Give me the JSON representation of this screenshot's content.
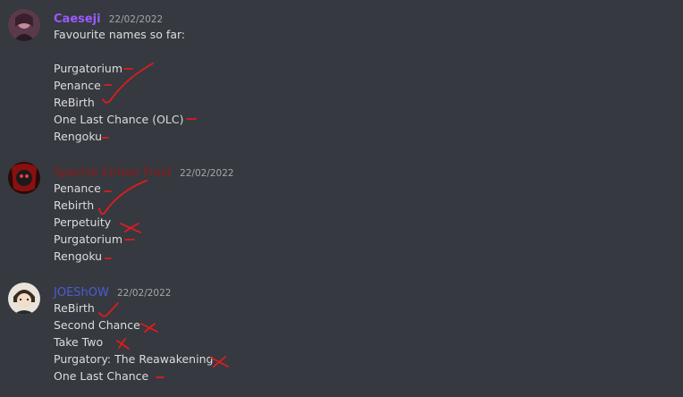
{
  "messages": [
    {
      "author": "Caeseji",
      "author_color": "#9b59ff",
      "timestamp": "22/02/2022",
      "lines": [
        "Favourite names so far:",
        "",
        "Purgatorium",
        "Penance",
        "ReBirth",
        "One Last Chance (OLC)",
        "Rengoku"
      ]
    },
    {
      "author": "Spectre Ember Frost",
      "author_color": "#8b1a1a",
      "timestamp": "22/02/2022",
      "lines": [
        "Penance",
        "Rebirth",
        "Perpetuity",
        "Purgatorium",
        "Rengoku"
      ]
    },
    {
      "author": "JOEShOW",
      "author_color": "#4e5bd6",
      "timestamp": "22/02/2022",
      "lines": [
        "ReBirth",
        "Second Chance",
        "Take Two",
        "Purgatory: The Reawakening",
        "One Last Chance"
      ]
    }
  ],
  "annotation_color": "#e01c1c"
}
